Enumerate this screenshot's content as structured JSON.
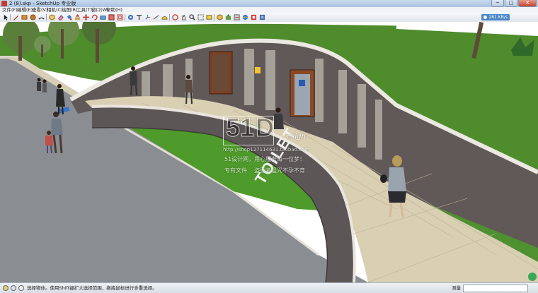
{
  "window": {
    "title": "2 (8).skp - SketchUp 专业版",
    "minimize": "─",
    "maximize": "□",
    "close": "✕"
  },
  "menu": [
    "文件(F)",
    "编辑(E)",
    "查看(V)",
    "相机(C)",
    "绘图(R)",
    "工具(T)",
    "窗口(W)",
    "帮助(H)"
  ],
  "toolbar_icons": [
    "select-arrow-icon",
    "line-pencil-icon",
    "rectangle-icon",
    "circle-icon",
    "arc-icon",
    "make-component-icon",
    "eraser-icon",
    "paint-bucket-icon",
    "push-pull-icon",
    "move-icon",
    "rotate-icon",
    "follow-me-icon",
    "scale-icon",
    "offset-icon",
    "tape-measure-icon",
    "text-icon",
    "axes-icon",
    "dimension-icon",
    "protractor-icon",
    "orbit-icon",
    "pan-icon",
    "zoom-icon",
    "zoom-window-icon",
    "zoom-extents-icon",
    "get-models-icon",
    "share-model-icon",
    "share-component-icon",
    "photo-textures-icon",
    "extension-warehouse-icon",
    "layout-icon"
  ],
  "badge": {
    "label": "281 KB/s"
  },
  "scene": {
    "sign_text": "TOILET",
    "watermark": {
      "logo_digits": "51",
      "logo_letter": "D",
      "logo_suffix": "esign",
      "url": "http://shop127114631.taobao.com",
      "slogan": "51设计网，用心服务每一位梦！",
      "footer_left": "专有文件",
      "footer_right": "盗图者诅咒不孕不育"
    }
  },
  "status": {
    "message": "选择物体。使用Shift键扩大选择范围，拖拽鼠标进行多重选择。",
    "measure_label": "测量",
    "measure_value": ""
  },
  "colors": {
    "grass": "#4f8f2e",
    "road": "#8b8f93",
    "wall_dark": "#5b5454",
    "plaza": "#d9cfb4",
    "sky": "#ffffff"
  }
}
